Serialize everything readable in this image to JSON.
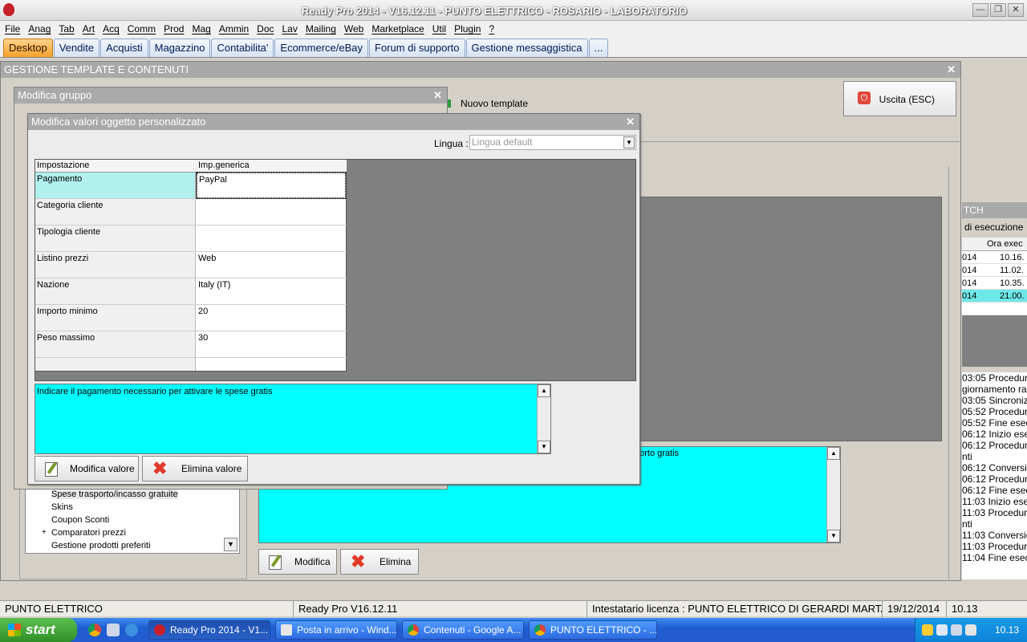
{
  "window": {
    "title": "Ready Pro 2014 - V16.12.11 - PUNTO ELETTRICO - ROSARIO - LABORATORIO"
  },
  "menu": [
    "File",
    "Anag",
    "Tab",
    "Art",
    "Acq",
    "Comm",
    "Prod",
    "Mag",
    "Ammin",
    "Doc",
    "Lav",
    "Mailing",
    "Web",
    "Marketplace",
    "Util",
    "Plugin",
    "?"
  ],
  "tabs": [
    "Desktop",
    "Vendite",
    "Acquisti",
    "Magazzino",
    "Contabilita'",
    "Ecommerce/eBay",
    "Forum di supporto",
    "Gestione messaggistica",
    "..."
  ],
  "gestione": {
    "title": "GESTIONE TEMPLATE E CONTENUTI",
    "uscita_label": "Uscita (ESC)",
    "nuovo_template_label": "Nuovo template",
    "tree_items": [
      "Spese trasporto/incasso gratuite",
      "Skins",
      "Coupon Sconti",
      "Comparatori prezzi",
      "Gestione prodotti preferiti"
    ],
    "desc_fragment": "porto gratis",
    "modifica_label": "Modifica",
    "elimina_label": "Elimina"
  },
  "gruppo": {
    "title": "Modifica gruppo"
  },
  "modal": {
    "title": "Modifica valori oggetto personalizzato",
    "lingua_label": "Lingua :",
    "lingua_value": "Lingua default",
    "col_impostazione": "Impostazione",
    "col_generica": "Imp.generica",
    "rows": [
      {
        "key": "Pagamento",
        "value": "PayPal"
      },
      {
        "key": "Categoria cliente",
        "value": ""
      },
      {
        "key": "Tipologia cliente",
        "value": ""
      },
      {
        "key": "Listino prezzi",
        "value": "Web"
      },
      {
        "key": "Nazione",
        "value": "Italy (IT)"
      },
      {
        "key": "Importo minimo",
        "value": "20"
      },
      {
        "key": "Peso massimo",
        "value": "30"
      }
    ],
    "description": "Indicare il pagamento necessario per attivare le spese gratis",
    "modifica_valore_label": "Modifica valore",
    "elimina_valore_label": "Elimina valore"
  },
  "batch": {
    "title": "TCH",
    "label": "di esecuzione",
    "col_ora": "Ora exec",
    "rows": [
      {
        "a": "014",
        "b": "10.16."
      },
      {
        "a": "014",
        "b": "11.02."
      },
      {
        "a": "014",
        "b": "10.35."
      },
      {
        "a": "014",
        "b": "21.00."
      }
    ],
    "log": [
      "03:05 Procedur",
      "giornamento ra",
      "03:05 Sincroniz",
      "05:52 Procedur",
      "05:52 Fine esec",
      "06:12 Inizio ese",
      "06:12 Procedur",
      "nti",
      "06:12 Conversio",
      "06:12 Procedur",
      "06:12 Fine esec",
      "11:03 Inizio ese",
      "11:03 Procedur",
      "nti",
      "11:03 Conversio",
      "11:03 Procedur",
      "11:04 Fine esec"
    ]
  },
  "status": {
    "company": "PUNTO ELETTRICO",
    "version": "Ready Pro V16.12.11",
    "license": "Intestatario licenza : PUNTO ELETTRICO DI GERARDI MARTA",
    "date": "19/12/2014",
    "time": "10.13"
  },
  "taskbar": {
    "start": "start",
    "tasks": [
      "Ready Pro 2014 - V1...",
      "Posta in arrivo - Wind...",
      "Contenuti - Google A...",
      "PUNTO ELETTRICO - ..."
    ],
    "clock": "10.13"
  }
}
